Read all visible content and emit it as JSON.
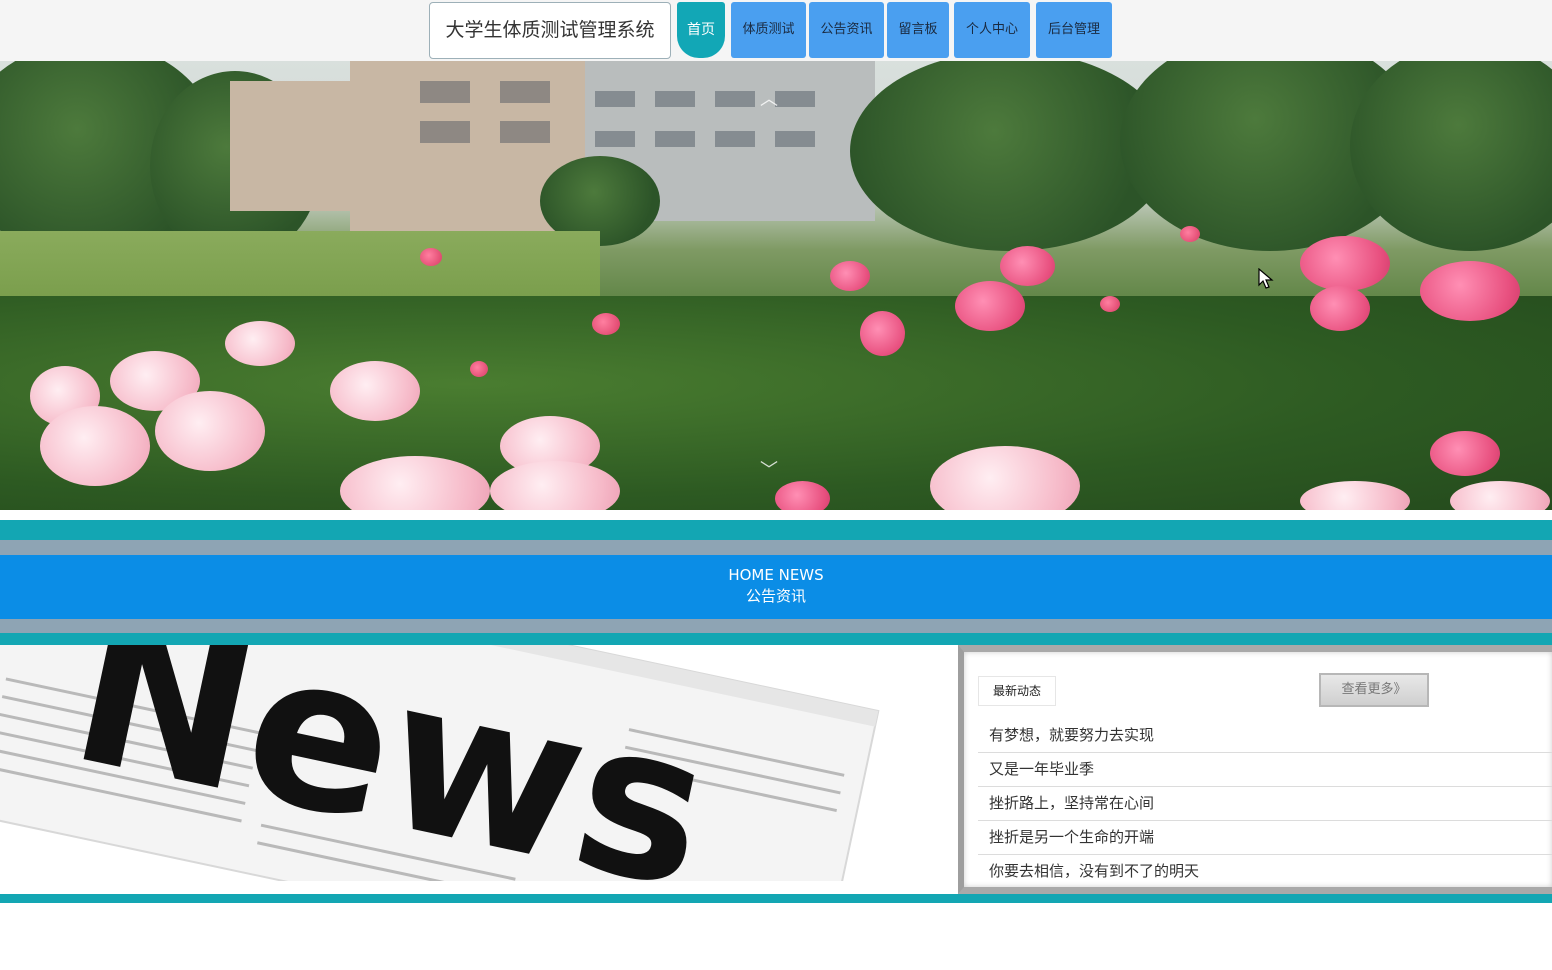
{
  "header": {
    "site_title": "大学生体质测试管理系统",
    "nav": [
      {
        "label": "首页",
        "active": true
      },
      {
        "label": "体质测试",
        "active": false
      },
      {
        "label": "公告资讯",
        "active": false
      },
      {
        "label": "留言板",
        "active": false
      },
      {
        "label": "个人中心",
        "active": false
      },
      {
        "label": "后台管理",
        "active": false
      }
    ]
  },
  "banner": {
    "icons": [
      "chevron-up-icon",
      "chevron-down-icon",
      "mouse-cursor-icon"
    ]
  },
  "news_section": {
    "heading_en": "HOME NEWS",
    "heading_cn": "公告资讯",
    "image_word": "News",
    "panel": {
      "tag": "最新动态",
      "more_button": "查看更多》",
      "items": [
        "有梦想，就要努力去实现",
        "又是一年毕业季",
        "挫折路上，坚持常在心间",
        "挫折是另一个生命的开端",
        "你要去相信，没有到不了的明天"
      ]
    }
  },
  "colors": {
    "teal": "#13a6b3",
    "nav_blue": "#4a9ff0",
    "heading_blue": "#0b8de6",
    "gray_bar": "#8ea4b4"
  }
}
